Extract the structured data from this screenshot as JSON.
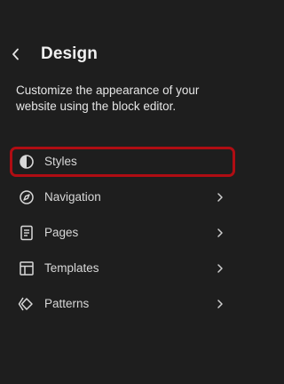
{
  "header": {
    "title": "Design",
    "back_icon": "chevron-left-icon"
  },
  "description": "Customize the appearance of your website using the block editor.",
  "nav": {
    "items": [
      {
        "label": "Styles",
        "icon": "half-circle-contrast-icon",
        "has_chevron": false,
        "highlighted": true
      },
      {
        "label": "Navigation",
        "icon": "compass-icon",
        "has_chevron": true
      },
      {
        "label": "Pages",
        "icon": "page-icon",
        "has_chevron": true
      },
      {
        "label": "Templates",
        "icon": "layout-icon",
        "has_chevron": true
      },
      {
        "label": "Patterns",
        "icon": "symbol-diamond-icon",
        "has_chevron": true
      }
    ]
  },
  "colors": {
    "background": "#1e1e1e",
    "text": "#e0e0e0",
    "highlight_border": "#b00d13"
  }
}
